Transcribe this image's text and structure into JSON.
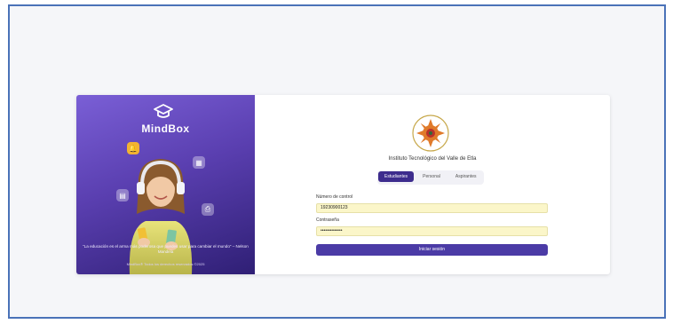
{
  "brand": {
    "name": "MindBox"
  },
  "promo": {
    "quote": "“La educación es el arma más poderosa que puedes usar para cambiar el mundo” – Nelson Mandela",
    "footnote": "MindBox® Todos los derechos reservados ©2025"
  },
  "login": {
    "institute": "Instituto Tecnológico del Valle de Etla",
    "tabs": [
      "Estudiantes",
      "Personal",
      "Aspirantes"
    ],
    "active_tab": "Estudiantes",
    "username_label": "Número de control",
    "username_value": "19230900123",
    "password_label": "Contraseña",
    "password_value": "••••••••••••••",
    "submit_label": "Iniciar sesión"
  },
  "colors": {
    "frame_border": "#4a72b8",
    "panel_purple": "#5a3fb0",
    "primary_button": "#4b3ba6",
    "autofill_yellow": "#fbf6c9"
  }
}
